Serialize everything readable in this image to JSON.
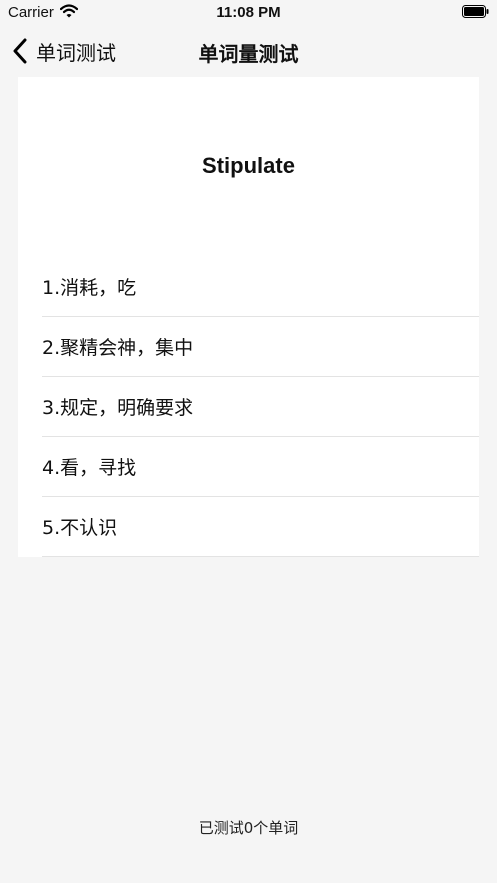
{
  "status_bar": {
    "carrier": "Carrier",
    "time": "11:08 PM"
  },
  "nav": {
    "back_label": "单词测试",
    "title": "单词量测试"
  },
  "quiz": {
    "word": "Stipulate",
    "options": [
      "1.消耗，吃",
      "2.聚精会神，集中",
      "3.规定，明确要求",
      "4.看，寻找",
      "5.不认识"
    ]
  },
  "footer": {
    "tested_count": "已测试0个单词"
  },
  "icons": {
    "wifi": "wifi-icon",
    "battery": "battery-icon",
    "back": "chevron-left-icon"
  },
  "colors": {
    "background": "#f5f5f5",
    "card": "#ffffff",
    "divider": "#e3e3e3"
  }
}
